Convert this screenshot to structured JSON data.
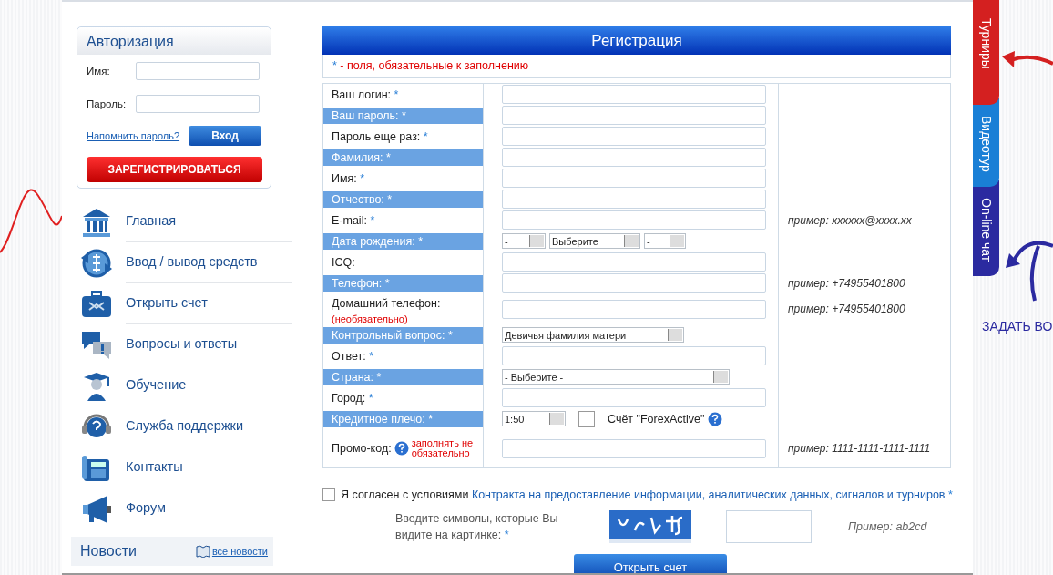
{
  "auth": {
    "title": "Авторизация",
    "fields": [
      {
        "label": "Имя:"
      },
      {
        "label": "Пароль:"
      }
    ],
    "forgot_link": "Напомнить пароль?",
    "login_button": "Вход",
    "register_button": "ЗАРЕГИСТРИРОВАТЬСЯ"
  },
  "menu": [
    {
      "label": "Главная",
      "kind": "bank"
    },
    {
      "label": "Ввод / вывод средств",
      "kind": "exchange"
    },
    {
      "label": "Открыть счет",
      "kind": "case"
    },
    {
      "label": "Вопросы и ответы",
      "kind": "faq"
    },
    {
      "label": "Обучение",
      "kind": "education"
    },
    {
      "label": "Служба поддержки",
      "kind": "support"
    },
    {
      "label": "Контакты",
      "kind": "phone"
    },
    {
      "label": "Форум",
      "kind": "megaphone"
    }
  ],
  "news": {
    "title": "Новости",
    "all_link": "все новости"
  },
  "registration": {
    "title": "Регистрация",
    "required_note": {
      "asterisk": "*",
      "text": " - поля, обязательные к заполнению"
    },
    "rows": [
      {
        "label": "Ваш логин:",
        "asterisk": "*",
        "shaded": false,
        "kind": "text"
      },
      {
        "label": "Ваш пароль:",
        "asterisk": "*",
        "shaded": true,
        "kind": "text"
      },
      {
        "label": "Пароль еще раз:",
        "asterisk": "*",
        "shaded": false,
        "kind": "text"
      },
      {
        "label": "Фамилия:",
        "asterisk": "*",
        "shaded": true,
        "kind": "text"
      },
      {
        "label": "Имя:",
        "asterisk": "*",
        "shaded": false,
        "kind": "text"
      },
      {
        "label": "Отчество:",
        "asterisk": "*",
        "shaded": true,
        "kind": "text"
      },
      {
        "label": "E-mail:",
        "asterisk": "*",
        "shaded": false,
        "kind": "text",
        "hint": "пример: xxxxxx@xxxx.xx"
      },
      {
        "label": "Дата рождения:",
        "asterisk": "*",
        "shaded": true,
        "kind": "date",
        "selects": [
          "-",
          "Выберите",
          "-"
        ]
      },
      {
        "label": "ICQ:",
        "shaded": false,
        "kind": "text"
      },
      {
        "label": "Телефон:",
        "asterisk": "*",
        "shaded": true,
        "kind": "text",
        "hint": "пример: +74955401800"
      },
      {
        "label": "Домашний телефон:",
        "note": "(необязательно)",
        "shaded": false,
        "kind": "text",
        "hint": "пример: +74955401800"
      },
      {
        "label": "Контрольный вопрос:",
        "asterisk": "*",
        "shaded": true,
        "kind": "select",
        "value": "Девичья фамилия матери"
      },
      {
        "label": "Ответ:",
        "asterisk": "*",
        "shaded": false,
        "kind": "text"
      },
      {
        "label": "Страна:",
        "asterisk": "*",
        "shaded": true,
        "kind": "select-wide",
        "value": "- Выберите -"
      },
      {
        "label": "Город:",
        "asterisk": "*",
        "shaded": false,
        "kind": "text"
      },
      {
        "label": "Кредитное плечо:",
        "asterisk": "*",
        "shaded": true,
        "kind": "leverage",
        "value": "1:50",
        "checked": false,
        "check_label": "Счёт \"ForexActive\""
      },
      {
        "label": "Промо-код:",
        "note": "заполнять не обязательно",
        "shaded": false,
        "kind": "promo",
        "hint": "пример: 1111-1111-1111-1111"
      }
    ],
    "agreement": {
      "checked": false,
      "text": "Я согласен с условиями",
      "link": "Контракта на предоставление информации, аналитических данных, сигналов и турниров",
      "asterisk": "*"
    },
    "captcha": {
      "prompt": "Введите символы, которые Вы видите на картинке:",
      "asterisk": "*",
      "example": "Пример: ab2cd"
    },
    "submit": "Открыть счет"
  },
  "side_tabs": [
    {
      "label": "Турниры",
      "color": "#d42020"
    },
    {
      "label": "Видеотур",
      "color": "#1a7fd6"
    },
    {
      "label": "On-line чат",
      "color": "#2b2aa0"
    }
  ],
  "ask_link": "ЗАДАТЬ ВО"
}
